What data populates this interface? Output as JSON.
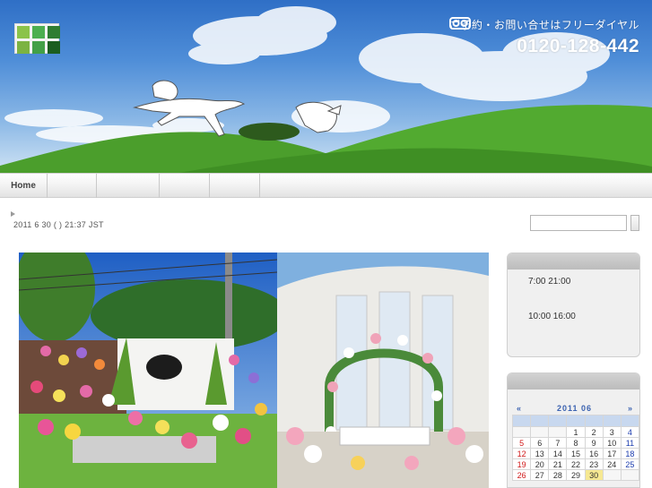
{
  "header": {
    "tagline": "ご予約・お問い合せはフリーダイヤル",
    "phone": "0120-128-442",
    "logo_colors": [
      "#8bc34a",
      "#4caf50",
      "#2e7d32",
      "#7cb342",
      "#43a047",
      "#1b5e20"
    ]
  },
  "nav": {
    "items": [
      {
        "label": "Home"
      },
      {
        "label": ""
      },
      {
        "label": ""
      },
      {
        "label": ""
      },
      {
        "label": ""
      }
    ]
  },
  "date_line": "2011  6  30  (  ) 21:37 JST",
  "search": {
    "placeholder": ""
  },
  "sidebar": {
    "hours": [
      "7:00 21:00",
      "10:00 16:00"
    ]
  },
  "calendar": {
    "prev": "«",
    "month": "2011  06",
    "next": "»",
    "weeks": [
      [
        "",
        "",
        "",
        "1",
        "2",
        "3",
        "4"
      ],
      [
        "5",
        "6",
        "7",
        "8",
        "9",
        "10",
        "11"
      ],
      [
        "12",
        "13",
        "14",
        "15",
        "16",
        "17",
        "18"
      ],
      [
        "19",
        "20",
        "21",
        "22",
        "23",
        "24",
        "25"
      ],
      [
        "26",
        "27",
        "28",
        "29",
        "30",
        "",
        ""
      ]
    ],
    "today": "30"
  },
  "colors": {
    "sky": "#4f8ed8",
    "grass": "#4ba32e",
    "calendar_accent": "#3b62b0",
    "sunday": "#d01818",
    "saturday": "#2040b0"
  }
}
